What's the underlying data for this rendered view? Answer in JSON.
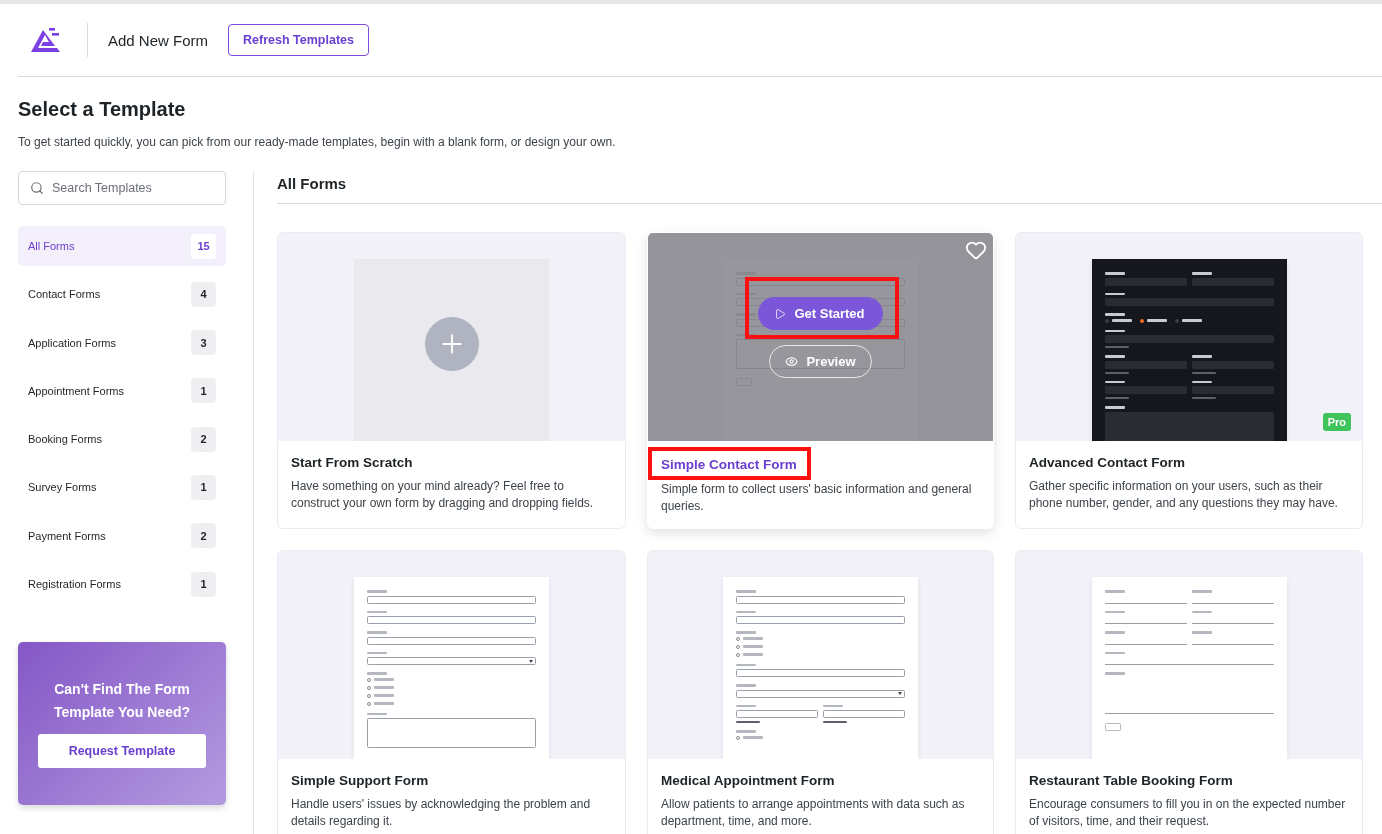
{
  "header": {
    "title": "Add New Form",
    "refresh_button": "Refresh Templates"
  },
  "heading": "Select a Template",
  "intro": "To get started quickly, you can pick from our ready-made templates, begin with a blank form, or design your own.",
  "search": {
    "placeholder": "Search Templates"
  },
  "categories": [
    {
      "label": "All Forms",
      "count": "15",
      "selected": true
    },
    {
      "label": "Contact Forms",
      "count": "4",
      "selected": false
    },
    {
      "label": "Application Forms",
      "count": "3",
      "selected": false
    },
    {
      "label": "Appointment Forms",
      "count": "1",
      "selected": false
    },
    {
      "label": "Booking Forms",
      "count": "2",
      "selected": false
    },
    {
      "label": "Survey Forms",
      "count": "1",
      "selected": false
    },
    {
      "label": "Payment Forms",
      "count": "2",
      "selected": false
    },
    {
      "label": "Registration Forms",
      "count": "1",
      "selected": false
    }
  ],
  "promo": {
    "title": "Can't Find The Form Template You Need?",
    "button": "Request Template"
  },
  "section_title": "All Forms",
  "templates": [
    {
      "title": "Start From Scratch",
      "description": "Have something on your mind already? Feel free to construct your own form by dragging and dropping fields.",
      "hovered": false,
      "thumbnail": {
        "kind": "blank"
      }
    },
    {
      "title": "Simple Contact Form",
      "description": "Simple form to collect users' basic information and general queries.",
      "hovered": true,
      "title_highlighted": true,
      "actions": [
        {
          "label": "Get Started",
          "kind": "primary",
          "highlighted": true
        },
        {
          "label": "Preview",
          "kind": "outline",
          "highlighted": false
        }
      ],
      "thumbnail": {
        "kind": "form",
        "dark": false,
        "rows": [
          {
            "fields": [
              {
                "kind": "input"
              }
            ]
          },
          {
            "fields": [
              {
                "kind": "input"
              }
            ]
          },
          {
            "fields": [
              {
                "kind": "input"
              }
            ]
          },
          {
            "fields": [
              {
                "kind": "textarea"
              }
            ]
          },
          {
            "fields": [
              {
                "kind": "button"
              }
            ]
          }
        ]
      }
    },
    {
      "title": "Advanced Contact Form",
      "description": "Gather specific information on your users, such as their phone number, gender, and any questions they may have.",
      "hovered": false,
      "badge": "Pro",
      "thumbnail": {
        "kind": "form",
        "dark": true,
        "rows": [
          {
            "fields": [
              {
                "kind": "input"
              },
              {
                "kind": "input"
              }
            ]
          },
          {
            "fields": [
              {
                "kind": "input"
              }
            ]
          },
          {
            "fields": [
              {
                "kind": "choice-inline",
                "options": [
                  {
                    "selected": false
                  },
                  {
                    "selected": true
                  },
                  {
                    "selected": false
                  }
                ]
              }
            ]
          },
          {
            "fields": [
              {
                "kind": "input",
                "hint": true
              }
            ]
          },
          {
            "fields": [
              {
                "kind": "input",
                "hint": true
              },
              {
                "kind": "input",
                "hint": true
              }
            ]
          },
          {
            "fields": [
              {
                "kind": "input",
                "hint": true
              },
              {
                "kind": "input",
                "hint": true
              }
            ]
          },
          {
            "fields": [
              {
                "kind": "textarea"
              }
            ]
          }
        ]
      }
    },
    {
      "title": "Simple Support Form",
      "description": "Handle users' issues by acknowledging the problem and details regarding it.",
      "hovered": false,
      "thumbnail": {
        "kind": "form",
        "dark": false,
        "rows": [
          {
            "fields": [
              {
                "kind": "input"
              }
            ]
          },
          {
            "fields": [
              {
                "kind": "input"
              }
            ]
          },
          {
            "fields": [
              {
                "kind": "input"
              }
            ]
          },
          {
            "fields": [
              {
                "kind": "select"
              }
            ]
          },
          {
            "fields": [
              {
                "kind": "choice",
                "options": [
                  {
                    "selected": false
                  },
                  {
                    "selected": false
                  },
                  {
                    "selected": false
                  },
                  {
                    "selected": false
                  }
                ]
              }
            ]
          },
          {
            "fields": [
              {
                "kind": "textarea"
              }
            ]
          }
        ]
      }
    },
    {
      "title": "Medical Appointment Form",
      "description": "Allow patients to arrange appointments with data such as department, time, and more.",
      "hovered": false,
      "thumbnail": {
        "kind": "form",
        "dark": false,
        "rows": [
          {
            "fields": [
              {
                "kind": "input"
              }
            ]
          },
          {
            "fields": [
              {
                "kind": "input"
              }
            ]
          },
          {
            "fields": [
              {
                "kind": "choice",
                "options": [
                  {
                    "selected": false
                  },
                  {
                    "selected": false
                  },
                  {
                    "selected": false
                  }
                ]
              }
            ]
          },
          {
            "fields": [
              {
                "kind": "input"
              }
            ]
          },
          {
            "fields": [
              {
                "kind": "select"
              }
            ]
          },
          {
            "fields": [
              {
                "kind": "input",
                "hint": true
              },
              {
                "kind": "input",
                "hint": true
              }
            ]
          },
          {
            "fields": [
              {
                "kind": "choice",
                "options": [
                  {
                    "selected": false
                  }
                ]
              }
            ]
          }
        ]
      }
    },
    {
      "title": "Restaurant Table Booking Form",
      "description": "Encourage consumers to fill you in on the expected number of visitors, time, and their request.",
      "hovered": false,
      "thumbnail": {
        "kind": "form",
        "dark": false,
        "rows": [
          {
            "fields": [
              {
                "kind": "line"
              },
              {
                "kind": "line"
              }
            ]
          },
          {
            "fields": [
              {
                "kind": "line"
              },
              {
                "kind": "line"
              }
            ]
          },
          {
            "fields": [
              {
                "kind": "line"
              },
              {
                "kind": "line"
              }
            ]
          },
          {
            "fields": [
              {
                "kind": "line"
              }
            ]
          },
          {
            "fields": [
              {
                "kind": "textarea-line"
              }
            ]
          },
          {
            "fields": [
              {
                "kind": "button"
              }
            ]
          }
        ]
      }
    }
  ]
}
